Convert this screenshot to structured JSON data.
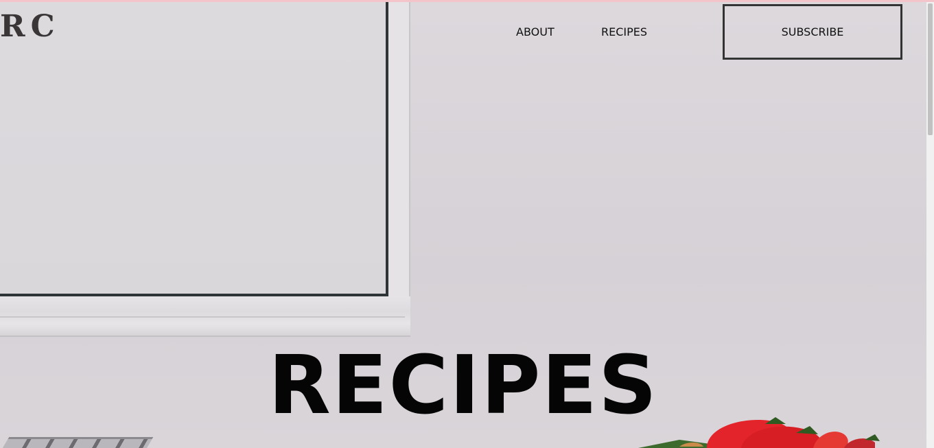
{
  "brand": {
    "logo_text": "RC"
  },
  "nav": {
    "items": [
      {
        "label": "ABOUT"
      },
      {
        "label": "RECIPES"
      }
    ],
    "subscribe_label": "SUBSCRIBE"
  },
  "hero": {
    "title": "RECIPES"
  },
  "colors": {
    "background": "#d8d3d8",
    "accent_line": "#f4c4cb",
    "text": "#111111",
    "button_border": "#333333"
  }
}
